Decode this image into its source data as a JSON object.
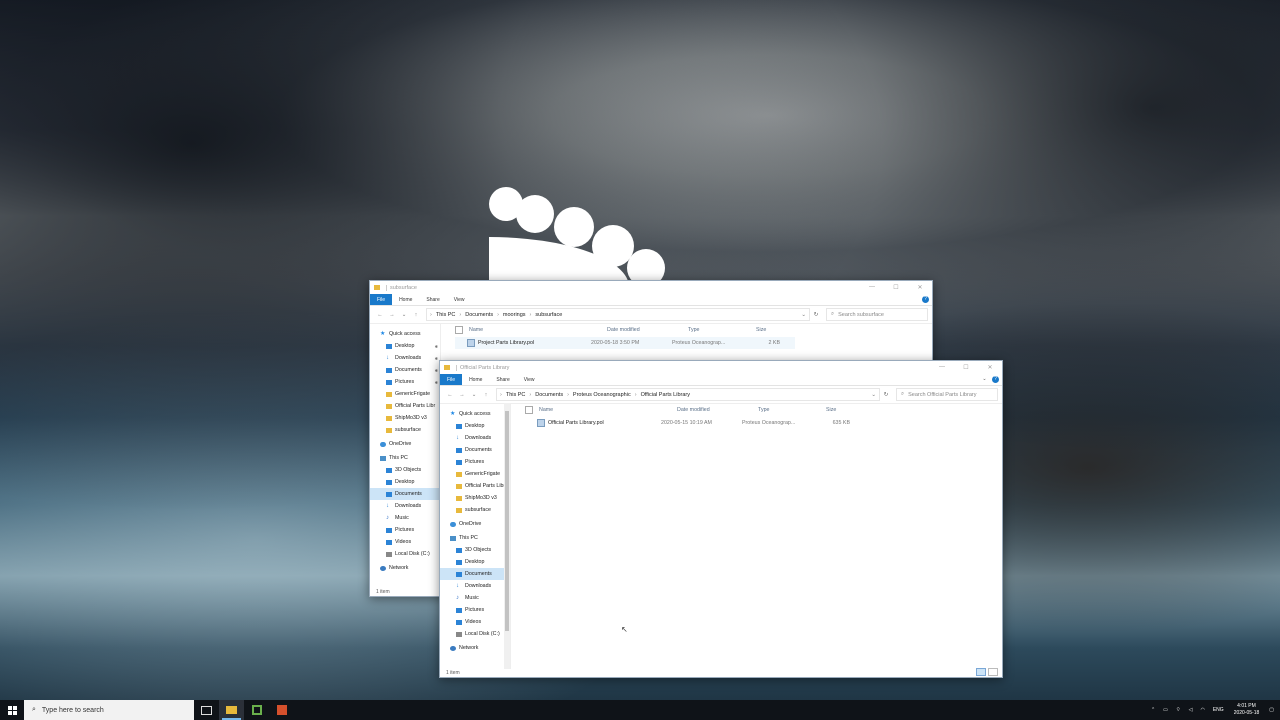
{
  "back_window": {
    "title": "subsurface",
    "ribbon": {
      "file": "File",
      "home": "Home",
      "share": "Share",
      "view": "View"
    },
    "path": [
      "This PC",
      "Documents",
      "moorings",
      "subsurface"
    ],
    "search_placeholder": "Search subsurface",
    "nav": [
      {
        "label": "Quick access",
        "icon": "star-icon",
        "level": 0
      },
      {
        "label": "Desktop",
        "icon": "desktop-icon",
        "level": 1,
        "pinned": true
      },
      {
        "label": "Downloads",
        "icon": "download-icon",
        "level": 1,
        "pinned": true
      },
      {
        "label": "Documents",
        "icon": "documents-icon",
        "level": 1,
        "pinned": true
      },
      {
        "label": "Pictures",
        "icon": "pictures-icon",
        "level": 1,
        "pinned": true
      },
      {
        "label": "GenericFrigate",
        "icon": "folder-icon",
        "level": 1
      },
      {
        "label": "Official Parts Libr",
        "icon": "folder-icon",
        "level": 1
      },
      {
        "label": "ShipMo3D v3",
        "icon": "folder-icon",
        "level": 1
      },
      {
        "label": "subsurface",
        "icon": "folder-icon",
        "level": 1
      },
      {
        "label": "OneDrive",
        "icon": "cloud-icon",
        "level": 0
      },
      {
        "label": "This PC",
        "icon": "pc-icon",
        "level": 0
      },
      {
        "label": "3D Objects",
        "icon": "3d-objects-icon",
        "level": 1
      },
      {
        "label": "Desktop",
        "icon": "desktop-icon",
        "level": 1
      },
      {
        "label": "Documents",
        "icon": "documents-icon",
        "level": 1,
        "selected": true
      },
      {
        "label": "Downloads",
        "icon": "download-icon",
        "level": 1
      },
      {
        "label": "Music",
        "icon": "music-icon",
        "level": 1
      },
      {
        "label": "Pictures",
        "icon": "pictures-icon",
        "level": 1
      },
      {
        "label": "Videos",
        "icon": "videos-icon",
        "level": 1
      },
      {
        "label": "Local Disk (C:)",
        "icon": "disk-icon",
        "level": 1
      },
      {
        "label": "Network",
        "icon": "network-icon",
        "level": 0
      }
    ],
    "columns": {
      "name": "Name",
      "date": "Date modified",
      "type": "Type",
      "size": "Size"
    },
    "files": [
      {
        "name": "Project Parts Library.pol",
        "date": "2020-05-18 3:50 PM",
        "type": "Proteus Oceanograp...",
        "size": "2 KB"
      }
    ],
    "status": "1 item"
  },
  "front_window": {
    "title": "Official Parts Library",
    "ribbon": {
      "file": "File",
      "home": "Home",
      "share": "Share",
      "view": "View"
    },
    "path": [
      "This PC",
      "Documents",
      "Proteus Oceanographic",
      "Official Parts Library"
    ],
    "search_placeholder": "Search Official Parts Library",
    "nav": [
      {
        "label": "Quick access",
        "icon": "star-icon",
        "level": 0
      },
      {
        "label": "Desktop",
        "icon": "desktop-icon",
        "level": 1,
        "pinned": true
      },
      {
        "label": "Downloads",
        "icon": "download-icon",
        "level": 1,
        "pinned": true
      },
      {
        "label": "Documents",
        "icon": "documents-icon",
        "level": 1,
        "pinned": true
      },
      {
        "label": "Pictures",
        "icon": "pictures-icon",
        "level": 1,
        "pinned": true
      },
      {
        "label": "GenericFrigate",
        "icon": "folder-icon",
        "level": 1
      },
      {
        "label": "Official Parts Libr",
        "icon": "folder-icon",
        "level": 1
      },
      {
        "label": "ShipMo3D v3",
        "icon": "folder-icon",
        "level": 1
      },
      {
        "label": "subsurface",
        "icon": "folder-icon",
        "level": 1
      },
      {
        "label": "OneDrive",
        "icon": "cloud-icon",
        "level": 0
      },
      {
        "label": "This PC",
        "icon": "pc-icon",
        "level": 0
      },
      {
        "label": "3D Objects",
        "icon": "3d-objects-icon",
        "level": 1
      },
      {
        "label": "Desktop",
        "icon": "desktop-icon",
        "level": 1
      },
      {
        "label": "Documents",
        "icon": "documents-icon",
        "level": 1,
        "selected": true
      },
      {
        "label": "Downloads",
        "icon": "download-icon",
        "level": 1
      },
      {
        "label": "Music",
        "icon": "music-icon",
        "level": 1
      },
      {
        "label": "Pictures",
        "icon": "pictures-icon",
        "level": 1
      },
      {
        "label": "Videos",
        "icon": "videos-icon",
        "level": 1
      },
      {
        "label": "Local Disk (C:)",
        "icon": "disk-icon",
        "level": 1
      },
      {
        "label": "Network",
        "icon": "network-icon",
        "level": 0
      }
    ],
    "columns": {
      "name": "Name",
      "date": "Date modified",
      "type": "Type",
      "size": "Size"
    },
    "files": [
      {
        "name": "Official Parts Library.pol",
        "date": "2020-05-15 10:19 AM",
        "type": "Proteus Oceanograp...",
        "size": "635 KB"
      }
    ],
    "status": "1 item"
  },
  "taskbar": {
    "search_placeholder": "Type here to search",
    "apps": [
      "task-view-icon",
      "file-explorer-icon",
      "green-app-icon",
      "red-app-icon"
    ],
    "tray": {
      "language": "ENG",
      "time": "4:01 PM",
      "date": "2020-05-18"
    }
  },
  "colors": {
    "accent": "#1979ca",
    "selection": "#cce4f7",
    "folder": "#e8b93c",
    "taskbar": "#0f1318"
  }
}
